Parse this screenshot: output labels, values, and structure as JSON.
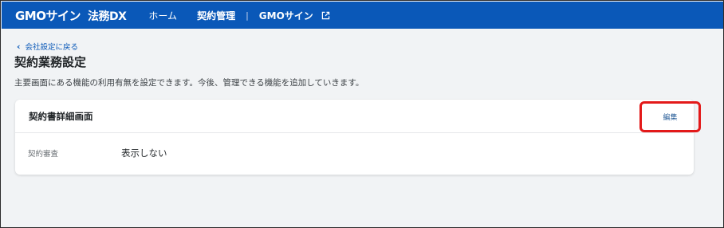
{
  "header": {
    "brand": "GMOサイン",
    "product": "法務DX",
    "nav": [
      {
        "label": "ホーム"
      },
      {
        "label": "契約管理"
      },
      {
        "label": "GMOサイン"
      }
    ],
    "separator": "|"
  },
  "back_link": {
    "label": "会社設定に戻る"
  },
  "page": {
    "title": "契約業務設定",
    "description": "主要画面にある機能の利用有無を設定できます。今後、管理できる機能を追加していきます。"
  },
  "card": {
    "title": "契約書詳細画面",
    "edit_label": "編集",
    "rows": [
      {
        "label": "契約審査",
        "value": "表示しない"
      }
    ]
  },
  "colors": {
    "header_bg": "#0a58b8",
    "highlight": "#e31919"
  }
}
